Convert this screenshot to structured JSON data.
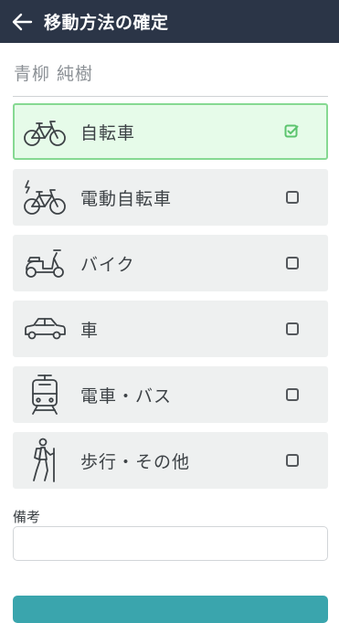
{
  "header": {
    "title": "移動方法の確定",
    "back_icon": "arrow-left-icon"
  },
  "user": {
    "name": "青柳 純樹"
  },
  "options": [
    {
      "label": "自転車",
      "icon": "bicycle-icon",
      "selected": true
    },
    {
      "label": "電動自転車",
      "icon": "electric-bicycle-icon",
      "selected": false
    },
    {
      "label": "バイク",
      "icon": "scooter-icon",
      "selected": false
    },
    {
      "label": "車",
      "icon": "car-icon",
      "selected": false
    },
    {
      "label": "電車・バス",
      "icon": "train-icon",
      "selected": false
    },
    {
      "label": "歩行・その他",
      "icon": "hiker-icon",
      "selected": false
    }
  ],
  "notes": {
    "label": "備考",
    "value": "",
    "placeholder": ""
  },
  "colors": {
    "header_bg": "#2b3547",
    "selected_bg": "#e6fbe9",
    "selected_border": "#86d992",
    "check_green": "#5cc46e",
    "option_bg": "#eef0f0",
    "button_bg": "#3aa5ad"
  }
}
